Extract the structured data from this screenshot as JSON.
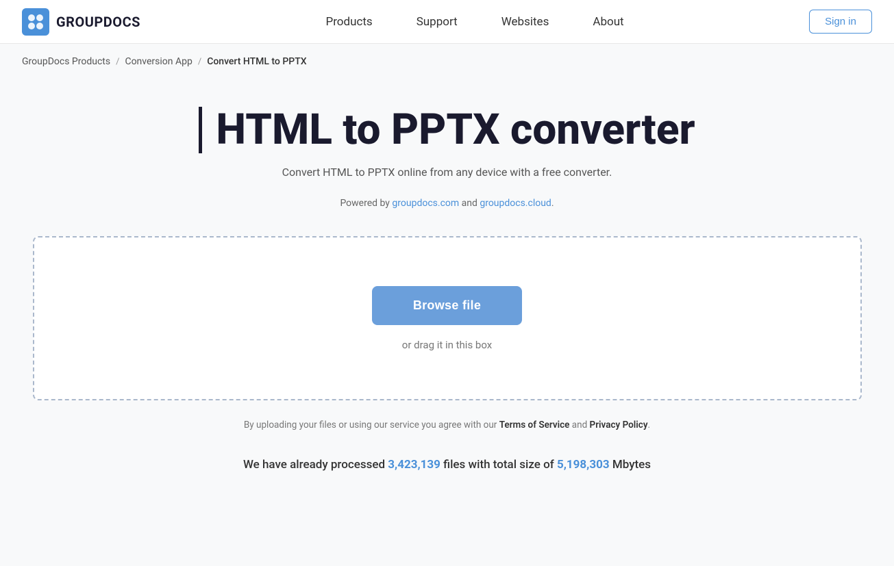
{
  "header": {
    "logo_text": "GROUPDOCS",
    "nav_items": [
      {
        "label": "Products",
        "id": "products"
      },
      {
        "label": "Support",
        "id": "support"
      },
      {
        "label": "Websites",
        "id": "websites"
      },
      {
        "label": "About",
        "id": "about"
      }
    ],
    "signin_label": "Sign in"
  },
  "breadcrumb": {
    "items": [
      {
        "label": "GroupDocs Products",
        "link": true
      },
      {
        "label": "Conversion App",
        "link": true
      },
      {
        "label": "Convert HTML to PPTX",
        "link": false
      }
    ]
  },
  "main": {
    "title": "HTML to PPTX converter",
    "subtitle": "Convert HTML to PPTX online from any device with a free converter.",
    "powered_by_prefix": "Powered by ",
    "powered_by_link1": "groupdocs.com",
    "powered_by_and": " and ",
    "powered_by_link2": "groupdocs.cloud",
    "powered_by_suffix": ".",
    "upload": {
      "browse_label": "Browse file",
      "drag_text": "or drag it in this box"
    },
    "terms": {
      "prefix": "By uploading your files or using our service you agree with our ",
      "link1": "Terms of Service",
      "and": " and ",
      "link2": "Privacy Policy",
      "suffix": "."
    },
    "stats": {
      "prefix": "We have already processed ",
      "files_count": "3,423,139",
      "middle": " files with total size of ",
      "size_count": "5,198,303",
      "suffix": " Mbytes"
    }
  }
}
